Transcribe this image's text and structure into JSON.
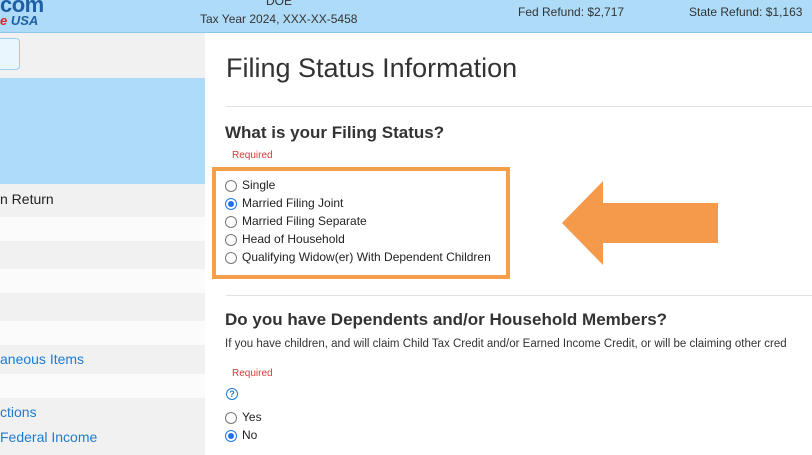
{
  "header": {
    "logo_top": "com",
    "logo_bottom_red": "e",
    "logo_bottom_blue": "USA",
    "taxpayer": "DOE",
    "tax_year": "Tax Year 2024, XXX-XX-5458",
    "fed_refund": "Fed Refund: $2,717",
    "state_refund": "State Refund: $1,163"
  },
  "sidebar": {
    "items": [
      {
        "label": "n Return"
      },
      {
        "label": "aneous Items"
      },
      {
        "label": "ctions"
      },
      {
        "label": "Federal Income"
      }
    ]
  },
  "main": {
    "title": "Filing Status Information",
    "filing_status": {
      "question": "What is your Filing Status?",
      "required": "Required",
      "options": [
        {
          "label": "Single",
          "checked": false
        },
        {
          "label": "Married Filing Joint",
          "checked": true
        },
        {
          "label": "Married Filing Separate",
          "checked": false
        },
        {
          "label": "Head of Household",
          "checked": false
        },
        {
          "label": "Qualifying Widow(er) With Dependent Children",
          "checked": false
        }
      ]
    },
    "dependents": {
      "question": "Do you have Dependents and/or Household Members?",
      "description": "If you have children, and will claim Child Tax Credit and/or Earned Income Credit, or will be claiming other cred",
      "required": "Required",
      "help_icon": "?",
      "options": [
        {
          "label": "Yes",
          "checked": false
        },
        {
          "label": "No",
          "checked": true
        }
      ]
    }
  },
  "colors": {
    "header_bg": "#aedcf8",
    "highlight_border": "#f4a04a",
    "arrow": "#f59a4a",
    "link": "#1e7bd2",
    "required": "#d83a3a"
  }
}
